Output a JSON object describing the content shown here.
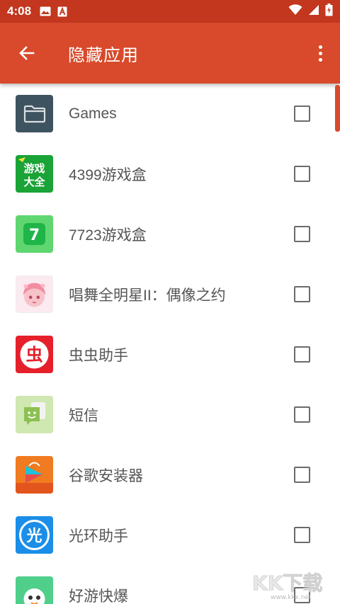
{
  "status_bar": {
    "time": "4:08",
    "icons": [
      "image-icon",
      "text-a-icon",
      "wifi-icon",
      "signal-icon",
      "battery-icon"
    ]
  },
  "app_bar": {
    "title": "隐藏应用",
    "back_icon": "arrow-left-icon",
    "menu_icon": "more-vert-icon"
  },
  "apps": [
    {
      "name": "Games",
      "icon": "folder-icon",
      "checked": false
    },
    {
      "name": "4399游戏盒",
      "icon": "game-box-4399-icon",
      "icon_text": "游戏大全",
      "checked": false
    },
    {
      "name": "7723游戏盒",
      "icon": "game-box-7723-icon",
      "icon_text": "7",
      "checked": false
    },
    {
      "name": "唱舞全明星II：偶像之约",
      "icon": "anime-girl-icon",
      "checked": false
    },
    {
      "name": "虫虫助手",
      "icon": "chongchong-icon",
      "icon_text": "虫",
      "checked": false
    },
    {
      "name": "短信",
      "icon": "sms-icon",
      "checked": false
    },
    {
      "name": "谷歌安装器",
      "icon": "google-installer-icon",
      "checked": false
    },
    {
      "name": "光环助手",
      "icon": "guanghuan-icon",
      "icon_text": "光",
      "checked": false
    },
    {
      "name": "好游快爆",
      "icon": "haoyou-icon",
      "checked": false
    }
  ],
  "watermark": {
    "text": "KK下载",
    "subtext": "www.kkx.net"
  },
  "colors": {
    "status_bar": "#c2371e",
    "app_bar": "#d84a2b",
    "text": "#555555",
    "checkbox_border": "#6b6b6b"
  }
}
